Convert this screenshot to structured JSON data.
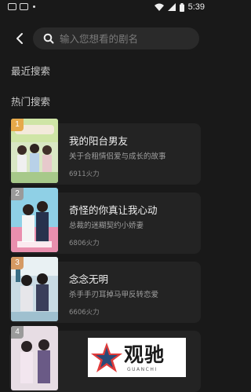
{
  "status_bar": {
    "time": "5:39"
  },
  "search": {
    "placeholder": "输入您想看的剧名"
  },
  "sections": {
    "recent": "最近搜索",
    "hot": "热门搜索"
  },
  "dramas": [
    {
      "rank": "1",
      "title": "我的阳台男友",
      "desc": "关于合租情侣爱与成长的故事",
      "heat": "6911火力",
      "rank_color": "#e6a94a"
    },
    {
      "rank": "2",
      "title": "奇怪的你真让我心动",
      "desc": "总裁的迷糊契约小娇妻",
      "heat": "6806火力",
      "rank_color": "#9a9a9a"
    },
    {
      "rank": "3",
      "title": "念念无明",
      "desc": "杀手手刃耳掉马甲反转恋爱",
      "heat": "6606火力",
      "rank_color": "#d59a63"
    },
    {
      "rank": "4",
      "title": "",
      "desc": "",
      "heat": "",
      "rank_color": "#9a9a9a"
    }
  ],
  "watermark": {
    "text": "观驰",
    "sub": "GUANCHI"
  }
}
